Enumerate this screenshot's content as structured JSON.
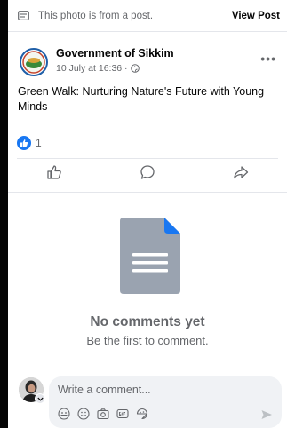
{
  "info_bar": {
    "text": "This photo is from a post.",
    "view_post_label": "View Post"
  },
  "post": {
    "author": "Government of Sikkim",
    "timestamp": "10 July at 16:36 ·",
    "text": "Green Walk: Nurturing Nature's Future with Young Minds",
    "reaction_count": "1"
  },
  "comments": {
    "empty_title": "No comments yet",
    "empty_subtitle": "Be the first to comment."
  },
  "composer": {
    "placeholder": "Write a comment..."
  },
  "colors": {
    "accent": "#1877f2",
    "muted_text": "#65676b",
    "doc_gray": "#9aa3b0"
  },
  "icons": {
    "info": "photo-caption-icon",
    "globe": "globe-icon",
    "like": "like-icon",
    "comment": "comment-icon",
    "share": "share-icon",
    "document": "document-icon",
    "avatar_sticker": "avatar-sticker-icon",
    "emoji": "emoji-icon",
    "camera": "camera-icon",
    "gif": "gif-icon",
    "sticker": "sticker-icon",
    "send": "send-icon"
  }
}
